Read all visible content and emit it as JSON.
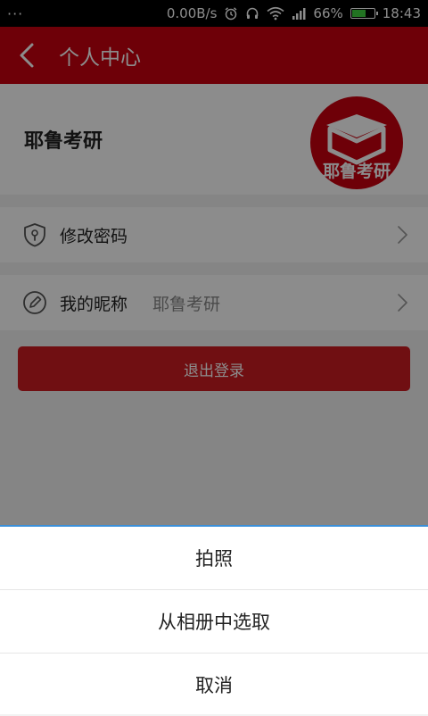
{
  "status_bar": {
    "dots": "···",
    "net_speed": "0.00B/s",
    "battery_pct": "66%",
    "battery_level": 0.66,
    "time": "18:43"
  },
  "header": {
    "title": "个人中心"
  },
  "profile": {
    "name": "耶鲁考研",
    "logo_text": "耶鲁考研"
  },
  "menu": {
    "change_password": "修改密码",
    "nickname_label": "我的昵称",
    "nickname_value": "耶鲁考研"
  },
  "logout_label": "退出登录",
  "sheet": {
    "options": [
      "拍照",
      "从相册中选取",
      "取消"
    ]
  },
  "colors": {
    "brand_red": "#c8000f",
    "button_red": "#cc1c22",
    "sheet_accent": "#3a8fd9"
  }
}
